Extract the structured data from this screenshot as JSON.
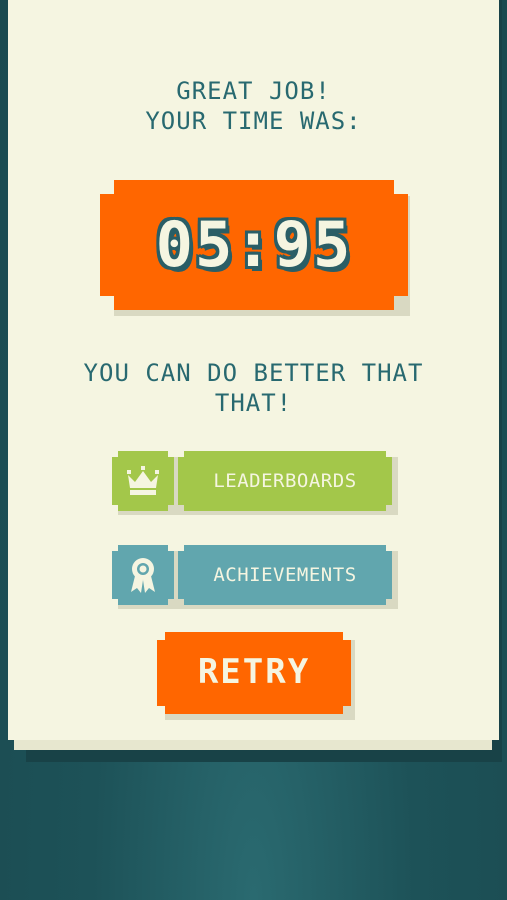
{
  "result": {
    "headline_line1": "GREAT JOB!",
    "headline_line2": "YOUR TIME WAS:",
    "time": "05:95",
    "message": "YOU CAN DO BETTER THAT THAT!"
  },
  "buttons": {
    "leaderboards": {
      "label": "LEADERBOARDS",
      "icon": "crown-icon"
    },
    "achievements": {
      "label": "ACHIEVEMENTS",
      "icon": "ribbon-award-icon"
    },
    "retry": {
      "label": "RETRY"
    }
  },
  "colors": {
    "background": "#1d5258",
    "panel": "#f5f5e1",
    "accent_orange": "#ff6600",
    "leaderboards_green": "#a3c74a",
    "achievements_teal": "#61a6ae",
    "text_teal": "#286970"
  }
}
